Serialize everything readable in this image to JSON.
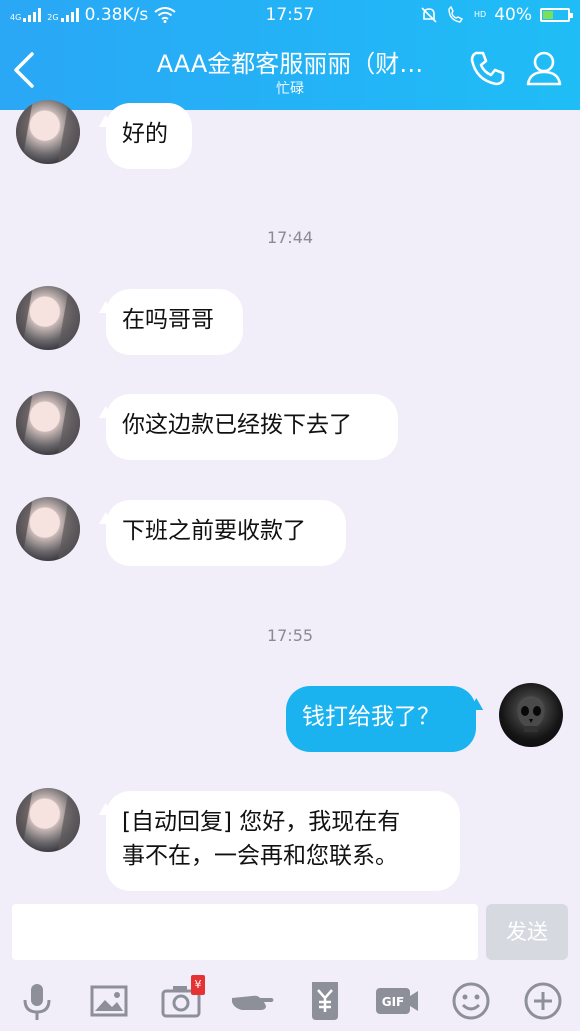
{
  "status_bar": {
    "network_left": "4G",
    "network_right": "2G",
    "speed": "0.38K/s",
    "time": "17:57",
    "hd": "HD",
    "battery": "40%",
    "battery_level": 0.4
  },
  "header": {
    "title": "AAA金都客服丽丽（财…",
    "subtitle": "忙碌"
  },
  "messages": [
    {
      "text": "好的"
    },
    {
      "time": "17:44"
    },
    {
      "text": "在吗哥哥"
    },
    {
      "text": "你这边款已经拨下去了"
    },
    {
      "text": "下班之前要收款了"
    },
    {
      "time": "17:55"
    },
    {
      "text": "钱打给我了？"
    },
    {
      "line1": "[自动回复] 您好，我现在有",
      "line2": "事不在，一会再和您联系。"
    }
  ],
  "input": {
    "value": "",
    "send_label": "发送"
  },
  "toolbar": {
    "red_packet_badge": "¥",
    "gif_label": "GIF"
  },
  "colors": {
    "header": "#23b4f7",
    "self_bubble": "#1ab3f0",
    "background": "#f1eef9"
  }
}
